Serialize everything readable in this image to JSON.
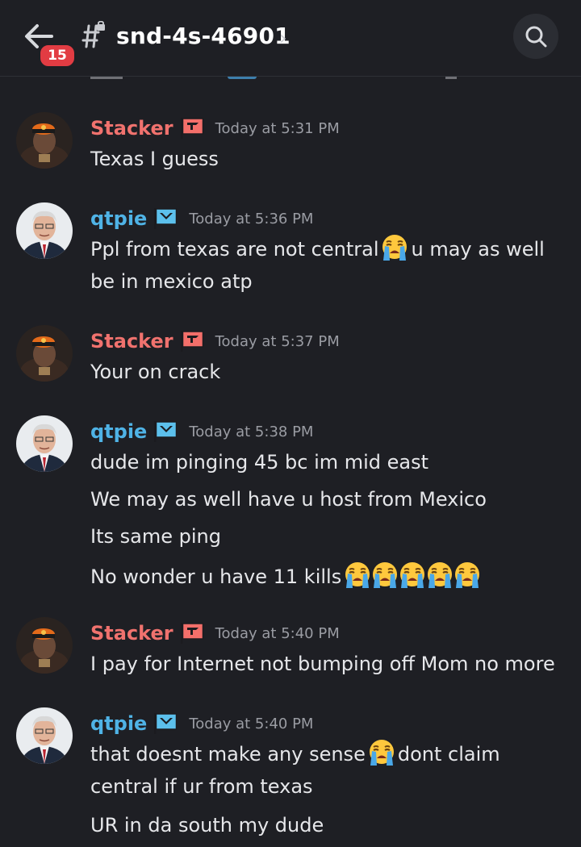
{
  "header": {
    "unread_count": "15",
    "channel_name": "snd-4s-46901",
    "chevron": "›",
    "back_icon": "arrow-left-icon",
    "channel_icon": "locked-hashtag-icon",
    "search_icon": "search-icon"
  },
  "colors": {
    "background": "#1e1f24",
    "stacker_name": "#f0726e",
    "qtpie_name": "#4fb3e6",
    "badge": "#e23c43",
    "timestamp": "#9a9ca3"
  },
  "messages": [
    {
      "author": "Stacker",
      "time": "Today at 5:31 PM",
      "lines": [
        "Texas I guess"
      ]
    },
    {
      "author": "qtpie",
      "time": "Today at 5:36 PM",
      "text_before_emoji": "Ppl from texas are not central",
      "text_after_emoji": "u may as well be in mexico atp",
      "emoji": "loudly-crying-face"
    },
    {
      "author": "Stacker",
      "time": "Today at 5:37 PM",
      "lines": [
        "Your on crack"
      ]
    },
    {
      "author": "qtpie",
      "time": "Today at 5:38 PM",
      "lines": [
        "dude im pinging 45 bc im mid east",
        "We may as well have u host from Mexico",
        "Its same ping",
        "No wonder u have 11 kills"
      ],
      "emoji": "loudly-crying-face",
      "emoji_count": 5
    },
    {
      "author": "Stacker",
      "time": "Today at 5:40 PM",
      "lines": [
        "I pay for Internet not bumping off Mom no more"
      ]
    },
    {
      "author": "qtpie",
      "time": "Today at 5:40 PM",
      "text_before_emoji": "that doesnt make any sense",
      "text_after_emoji": "dont claim central if ur from texas",
      "lines": [
        "UR in da south my dude"
      ],
      "emoji": "loudly-crying-face"
    }
  ]
}
